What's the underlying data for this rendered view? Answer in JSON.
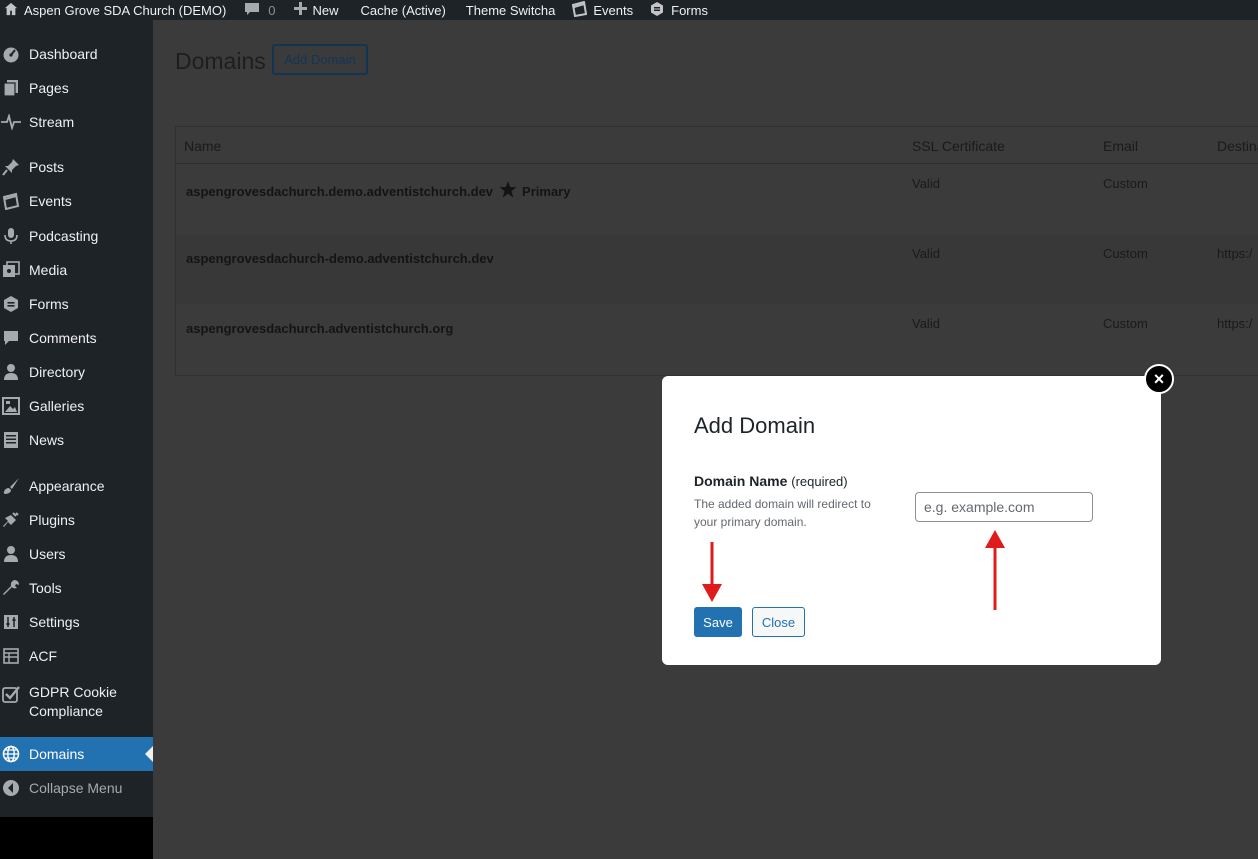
{
  "adminbar": {
    "site_name": "Aspen Grove SDA Church (DEMO)",
    "comments_count": "0",
    "new_label": "New",
    "cache_label": "Cache (Active)",
    "theme_switcha_label": "Theme Switcha",
    "events_label": "Events",
    "forms_label": "Forms"
  },
  "sidebar": {
    "items": [
      {
        "label": "Dashboard",
        "icon": "dashboard-icon"
      },
      {
        "label": "Pages",
        "icon": "pages-icon"
      },
      {
        "label": "Stream",
        "icon": "stream-icon"
      },
      {
        "label": "Posts",
        "icon": "pin-icon"
      },
      {
        "label": "Events",
        "icon": "calendar-icon"
      },
      {
        "label": "Podcasting",
        "icon": "microphone-icon"
      },
      {
        "label": "Media",
        "icon": "media-icon"
      },
      {
        "label": "Forms",
        "icon": "forms-icon"
      },
      {
        "label": "Comments",
        "icon": "comment-icon"
      },
      {
        "label": "Directory",
        "icon": "user-icon"
      },
      {
        "label": "Galleries",
        "icon": "gallery-icon"
      },
      {
        "label": "News",
        "icon": "news-icon"
      },
      {
        "label": "Appearance",
        "icon": "brush-icon"
      },
      {
        "label": "Plugins",
        "icon": "plugin-icon"
      },
      {
        "label": "Users",
        "icon": "users-icon"
      },
      {
        "label": "Tools",
        "icon": "wrench-icon"
      },
      {
        "label": "Settings",
        "icon": "settings-icon"
      },
      {
        "label": "ACF",
        "icon": "table-icon"
      },
      {
        "label": "GDPR Cookie Compliance",
        "icon": "checkbox-icon"
      },
      {
        "label": "Domains",
        "icon": "globe-icon",
        "current": true
      },
      {
        "label": "Collapse Menu",
        "icon": "collapse-icon"
      }
    ]
  },
  "page": {
    "title": "Domains",
    "add_domain_label": "Add Domain"
  },
  "table": {
    "columns": [
      "Name",
      "SSL Certificate",
      "Email",
      "Destina"
    ],
    "rows": [
      {
        "name": "aspengrovesdachurch.demo.adventistchurch.dev",
        "primary_label": "Primary",
        "ssl": "Valid",
        "email": "Custom",
        "destination": ""
      },
      {
        "name": "aspengrovesdachurch-demo.adventistchurch.dev",
        "primary_label": "",
        "ssl": "Valid",
        "email": "Custom",
        "destination": "https:/"
      },
      {
        "name": "aspengrovesdachurch.adventistchurch.org",
        "primary_label": "",
        "ssl": "Valid",
        "email": "Custom",
        "destination": "https:/"
      }
    ]
  },
  "modal": {
    "title": "Add Domain",
    "field_label": "Domain Name",
    "field_required": "(required)",
    "field_help": "The added domain will redirect to your primary domain.",
    "input_value": "",
    "input_placeholder": "e.g. example.com",
    "save_label": "Save",
    "close_label": "Close",
    "close_icon": "×"
  },
  "colors": {
    "accent": "#2271b1",
    "admin_bg": "#1d2327",
    "annotation_arrow": "#e01b1b"
  }
}
